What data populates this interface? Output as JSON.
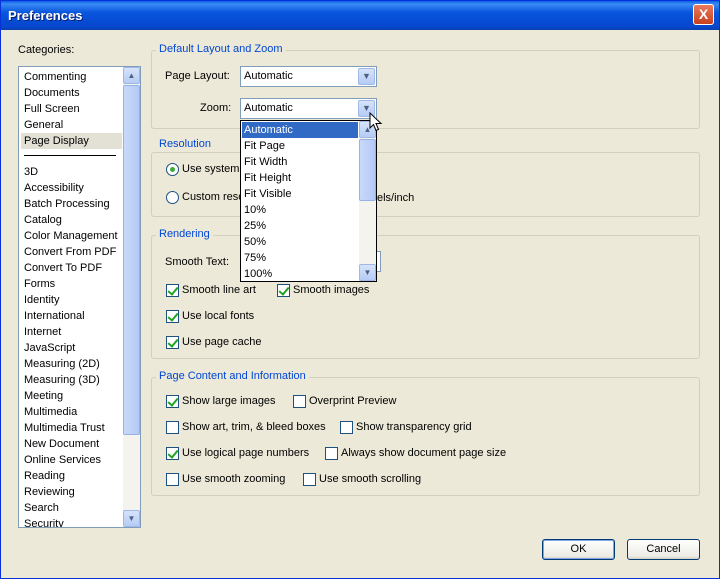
{
  "window": {
    "title": "Preferences",
    "close_label": "X"
  },
  "categories": {
    "label": "Categories:",
    "top_items": [
      "Commenting",
      "Documents",
      "Full Screen",
      "General",
      "Page Display"
    ],
    "selected": "Page Display",
    "bottom_items": [
      "3D",
      "Accessibility",
      "Batch Processing",
      "Catalog",
      "Color Management",
      "Convert From PDF",
      "Convert To PDF",
      "Forms",
      "Identity",
      "International",
      "Internet",
      "JavaScript",
      "Measuring (2D)",
      "Measuring (3D)",
      "Meeting",
      "Multimedia",
      "Multimedia Trust",
      "New Document",
      "Online Services",
      "Reading",
      "Reviewing",
      "Search",
      "Security"
    ]
  },
  "layout_group": {
    "title": "Default Layout and Zoom",
    "page_layout_label": "Page Layout:",
    "page_layout_value": "Automatic",
    "zoom_label": "Zoom:",
    "zoom_value": "Automatic",
    "zoom_options": [
      "Automatic",
      "Fit Page",
      "Fit Width",
      "Fit Height",
      "Fit Visible",
      "10%",
      "25%",
      "50%",
      "75%",
      "100%"
    ],
    "zoom_selected": "Automatic"
  },
  "resolution_group": {
    "title": "Resolution",
    "use_system_label": "Use system",
    "custom_label": "Custom reso",
    "units_label": "els/inch",
    "selected": "use_system"
  },
  "rendering_group": {
    "title": "Rendering",
    "smooth_text_label": "Smooth Text:",
    "smooth_line_art": {
      "label": "Smooth line art",
      "checked": true
    },
    "smooth_images": {
      "label": "Smooth images",
      "checked": true
    },
    "use_local_fonts": {
      "label": "Use local fonts",
      "checked": true
    },
    "use_page_cache": {
      "label": "Use page cache",
      "checked": true
    }
  },
  "content_group": {
    "title": "Page Content and Information",
    "show_large_images": {
      "label": "Show large images",
      "checked": true
    },
    "overprint_preview": {
      "label": "Overprint Preview",
      "checked": false
    },
    "show_art_trim_bleed": {
      "label": "Show art, trim, & bleed boxes",
      "checked": false
    },
    "show_transparency_grid": {
      "label": "Show transparency grid",
      "checked": false
    },
    "use_logical_page_numbers": {
      "label": "Use logical page numbers",
      "checked": true
    },
    "always_show_page_size": {
      "label": "Always show document page size",
      "checked": false
    },
    "use_smooth_zooming": {
      "label": "Use smooth zooming",
      "checked": false
    },
    "use_smooth_scrolling": {
      "label": "Use smooth scrolling",
      "checked": false
    }
  },
  "buttons": {
    "ok": "OK",
    "cancel": "Cancel"
  },
  "colors": {
    "titlebar": "#0A5FE6",
    "dialog_bg": "#ECE9D8",
    "group_title": "#0046D5",
    "selection": "#316AC5"
  }
}
